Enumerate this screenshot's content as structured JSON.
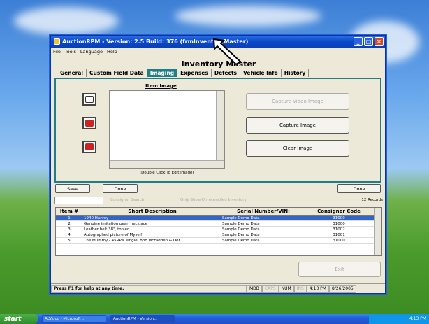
{
  "window": {
    "title": "AuctionRPM - Version: 2.5 Build: 376   (frmInventoryMaster)"
  },
  "menu": [
    "File",
    "Tools",
    "Language",
    "Help"
  ],
  "form": {
    "title": "Inventory Master"
  },
  "tabs": [
    "General",
    "Custom Field Data",
    "Imaging",
    "Expenses",
    "Defects",
    "Vehicle Info",
    "History"
  ],
  "imaging": {
    "image_label": "Item Image",
    "double_click_hint": "(Double Click To Edit Image)",
    "capture_video": "Capture Video Image",
    "capture_image": "Capture Image",
    "clear_image": "Clear Image"
  },
  "buttons": {
    "save": "Save",
    "done": "Done",
    "done_right": "Done",
    "exit": "Exit"
  },
  "search": {
    "consigner_search": "Consigner Search",
    "show_unreconciled": "Only Show Unreconciled Inventory",
    "records": "12 Records"
  },
  "grid": {
    "headers": [
      "Item #",
      "Short Description",
      "Serial Number/VIN:",
      "Consigner Code"
    ],
    "rows": [
      [
        "1",
        "1940 Harvey",
        "Sample Demo Data",
        "31000"
      ],
      [
        "2",
        "Genuine imitation pearl necklace",
        "Sample Demo Data",
        "31000"
      ],
      [
        "3",
        "Leather belt 38\", tooled",
        "Sample Demo Data",
        "31002"
      ],
      [
        "4",
        "Autographed picture of Myself",
        "Sample Demo Data",
        "31001"
      ],
      [
        "5",
        "The Mummy - 45RPM single, Bob McFadden & Dor",
        "Sample Demo Data",
        "31000"
      ]
    ]
  },
  "status": {
    "help": "Press F1 for help at any time.",
    "mdb": "MDB",
    "caps": "CAPS",
    "num": "NUM",
    "ins": "INS",
    "time": "4:13 PM",
    "date": "8/26/2005"
  },
  "taskbar": {
    "start": "start",
    "task1": "ALV.doc - Microsoft ...",
    "task2": "AuctionRPM - Version...",
    "clock": "4:13 PM"
  }
}
